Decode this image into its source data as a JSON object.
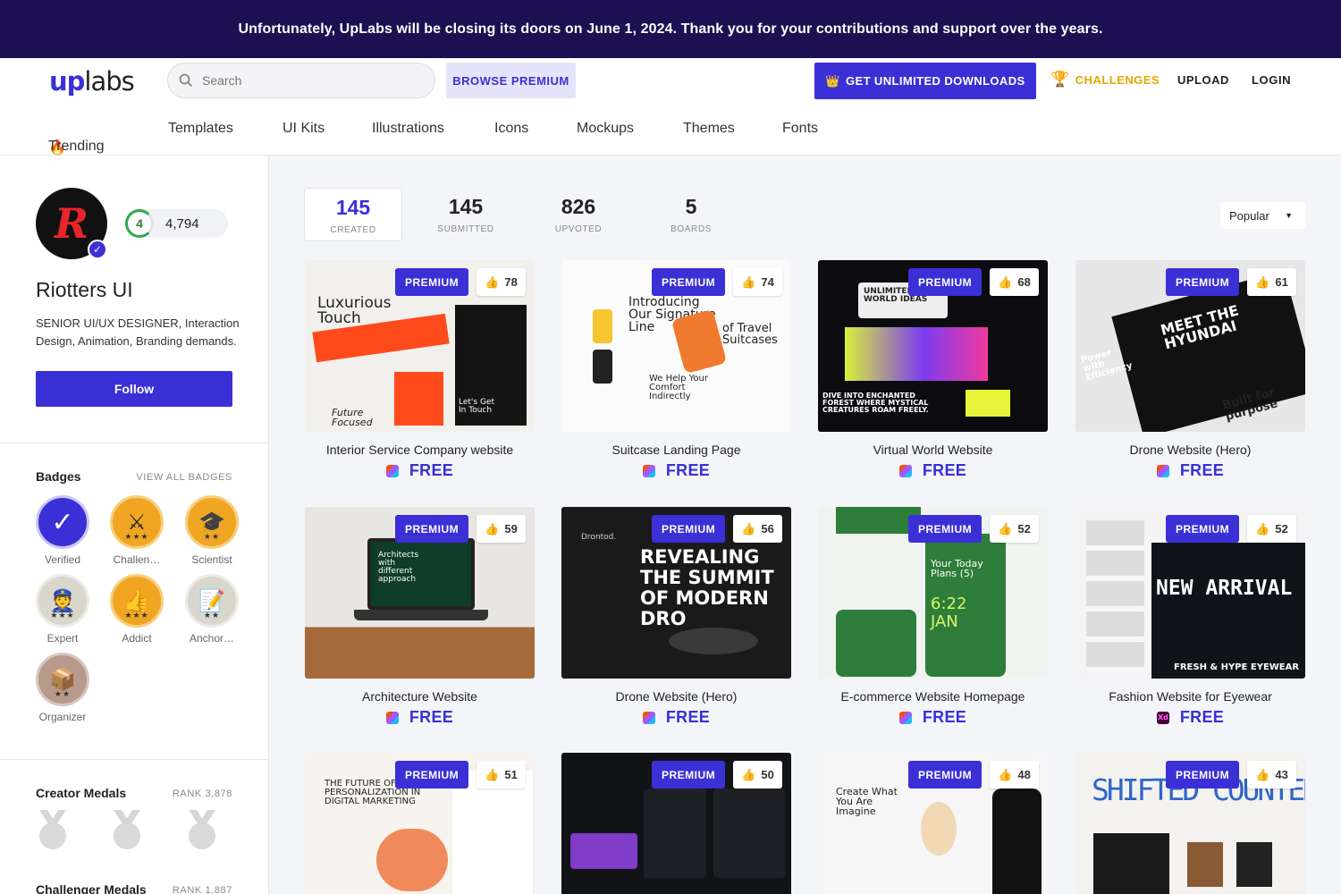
{
  "banner": {
    "text": "Unfortunately, UpLabs will be closing its doors on June 1, 2024. Thank you for your contributions and support over the years."
  },
  "header": {
    "logo_up": "up",
    "logo_labs": "labs",
    "search_placeholder": "Search",
    "browse_premium": "BROWSE PREMIUM",
    "get_unlimited": "GET UNLIMITED DOWNLOADS",
    "challenges": "CHALLENGES",
    "upload": "UPLOAD",
    "login": "LOGIN"
  },
  "categories": [
    "Trending",
    "Templates",
    "UI Kits",
    "Illustrations",
    "Icons",
    "Mockups",
    "Themes",
    "Fonts"
  ],
  "profile": {
    "name": "Riotters UI",
    "bio": "SENIOR UI/UX DESIGNER, Interaction Design, Animation, Branding demands.",
    "level": "4",
    "points": "4,794",
    "follow": "Follow"
  },
  "badges_section": {
    "title": "Badges",
    "view_all": "VIEW ALL BADGES",
    "items": [
      {
        "label": "Verified",
        "icon": "check-icon"
      },
      {
        "label": "Challen…",
        "icon": "sword-icon"
      },
      {
        "label": "Scientist",
        "icon": "grad-cap-icon"
      },
      {
        "label": "Expert",
        "icon": "person-icon"
      },
      {
        "label": "Addict",
        "icon": "thumbs-up-icon"
      },
      {
        "label": "Anchor…",
        "icon": "notepad-icon"
      },
      {
        "label": "Organizer",
        "icon": "box-icon"
      }
    ]
  },
  "creator_medals": {
    "title": "Creator Medals",
    "rank": "RANK 3,878"
  },
  "challenger_medals": {
    "title": "Challenger Medals",
    "rank": "RANK 1,887"
  },
  "stats": [
    {
      "value": "145",
      "caption": "CREATED"
    },
    {
      "value": "145",
      "caption": "SUBMITTED"
    },
    {
      "value": "826",
      "caption": "UPVOTED"
    },
    {
      "value": "5",
      "caption": "BOARDS"
    }
  ],
  "sort": {
    "selected": "Popular"
  },
  "cards": [
    {
      "title": "Interior Service Company website",
      "likes": "78",
      "premium": "PREMIUM",
      "price": "FREE",
      "tool": "figma"
    },
    {
      "title": "Suitcase Landing Page",
      "likes": "74",
      "premium": "PREMIUM",
      "price": "FREE",
      "tool": "figma"
    },
    {
      "title": "Virtual World Website",
      "likes": "68",
      "premium": "PREMIUM",
      "price": "FREE",
      "tool": "figma"
    },
    {
      "title": "Drone Website (Hero)",
      "likes": "61",
      "premium": "PREMIUM",
      "price": "FREE",
      "tool": "figma"
    },
    {
      "title": "Architecture Website",
      "likes": "59",
      "premium": "PREMIUM",
      "price": "FREE",
      "tool": "figma"
    },
    {
      "title": "Drone Website (Hero)",
      "likes": "56",
      "premium": "PREMIUM",
      "price": "FREE",
      "tool": "figma"
    },
    {
      "title": "E-commerce Website Homepage",
      "likes": "52",
      "premium": "PREMIUM",
      "price": "FREE",
      "tool": "figma"
    },
    {
      "title": "Fashion Website for Eyewear",
      "likes": "52",
      "premium": "PREMIUM",
      "price": "FREE",
      "tool": "xd"
    },
    {
      "title": "",
      "likes": "51",
      "premium": "PREMIUM",
      "price": "",
      "tool": ""
    },
    {
      "title": "",
      "likes": "50",
      "premium": "PREMIUM",
      "price": "",
      "tool": ""
    },
    {
      "title": "",
      "likes": "48",
      "premium": "PREMIUM",
      "price": "",
      "tool": ""
    },
    {
      "title": "",
      "likes": "43",
      "premium": "PREMIUM",
      "price": "",
      "tool": ""
    }
  ],
  "thumb_text": {
    "c1a": "Luxurious Touch",
    "c1b": "Future Focused",
    "c1c": "Let's Get In Touch",
    "c2a": "Introducing Our Signature Line",
    "c2b": "of Travel Suitcases",
    "c2c": "We Help Your Comfort Indirectly",
    "c3a": "UNLIMITED WORLD IDEAS",
    "c3b": "DIVE INTO ENCHANTED FOREST WHERE MYSTICAL CREATURES ROAM FREELY.",
    "c4a": "MEET THE HYUNDAI",
    "c4b": "Power with Efficiency",
    "c4c": "Built for purpose",
    "c5a": "Architects with different approach",
    "c6a": "REVEALING THE SUMMIT OF MODERN DRO",
    "c6b": "Drontod.",
    "c7a": "Your Today Plans (5)",
    "c7b": "6:22",
    "c7c": "JAN",
    "c8a": "NEW ARRIVAL",
    "c8b": "FRESH & HYPE EYEWEAR",
    "c9a": "THE FUTURE OF PERSONALIZATION IN DIGITAL MARKETING",
    "c11a": "Create What You Are Imagine",
    "c12a": "SHIFTED COUNTER"
  },
  "colors": {
    "accent": "#3b2fd6",
    "banner": "#1c1052",
    "gold": "#e0a800"
  }
}
